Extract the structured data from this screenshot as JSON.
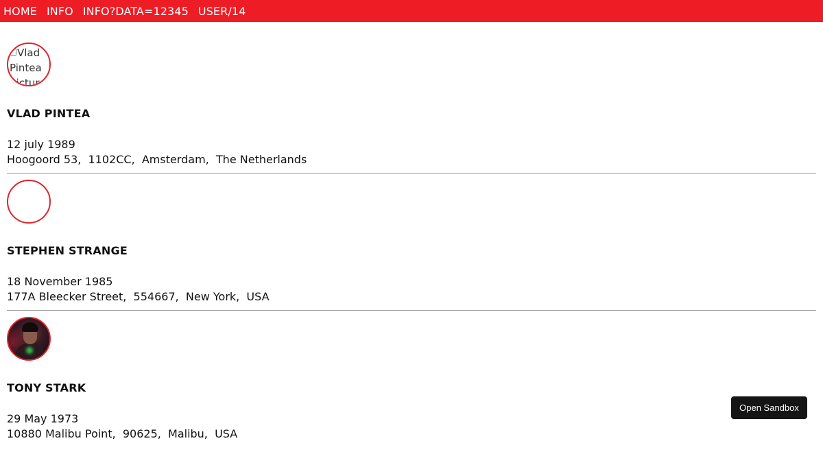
{
  "nav": {
    "items": [
      {
        "label": "HOME"
      },
      {
        "label": "INFO"
      },
      {
        "label": "INFO?DATA=12345"
      },
      {
        "label": "USER/14"
      }
    ]
  },
  "users": [
    {
      "avatar_alt": "Vlad Pintea picture",
      "name": "VLAD PINTEA",
      "birthdate": "12 july 1989",
      "address": "Hoogoord 53,  1102CC,  Amsterdam,  The Netherlands"
    },
    {
      "avatar_alt": "",
      "name": "STEPHEN STRANGE",
      "birthdate": "18 November 1985",
      "address": "177A Bleecker Street,  554667,  New York,  USA"
    },
    {
      "avatar_alt": "",
      "name": "TONY STARK",
      "birthdate": "29 May 1973",
      "address": "10880 Malibu Point,  90625,  Malibu,  USA"
    }
  ],
  "sandbox": {
    "label": "Open Sandbox"
  },
  "colors": {
    "nav_bg": "#ee1c25",
    "avatar_border": "#e0242b",
    "divider": "#9a9a9a",
    "sandbox_bg": "#151515"
  }
}
